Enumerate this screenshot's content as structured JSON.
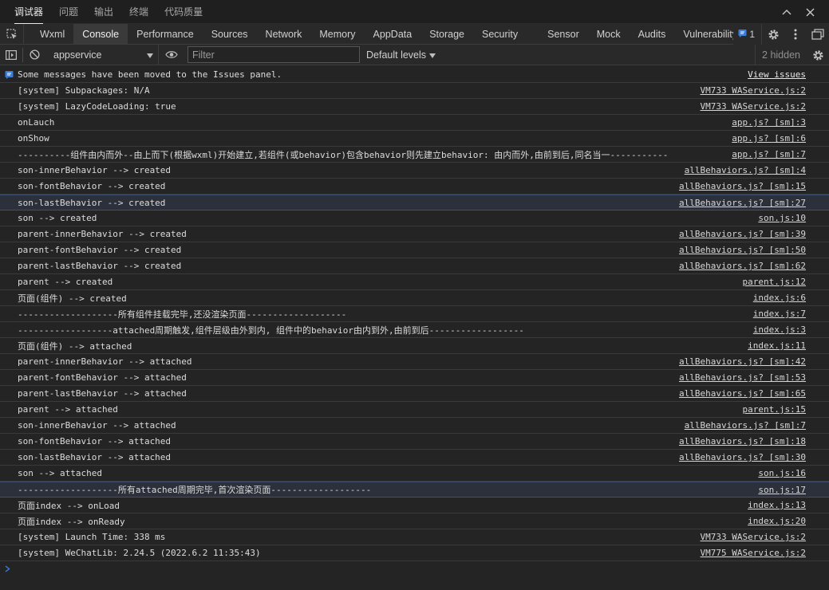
{
  "panel_tabs": [
    "调试器",
    "问题",
    "输出",
    "终端",
    "代码质量"
  ],
  "devtools_tabs": [
    "Wxml",
    "Console",
    "Performance",
    "Sources",
    "Network",
    "Memory",
    "AppData",
    "Storage",
    "Security",
    "Sensor",
    "Mock",
    "Audits",
    "Vulnerability"
  ],
  "issues_count": "1",
  "toolbar": {
    "context": "appservice",
    "filter_placeholder": "Filter",
    "levels": "Default levels",
    "hidden": "2 hidden"
  },
  "messages": [
    {
      "text": "Some messages have been moved to the Issues panel.",
      "src": "View issues"
    },
    {
      "text": "[system] Subpackages: N/A",
      "src": "VM733 WAService.js:2"
    },
    {
      "text": "[system] LazyCodeLoading: true",
      "src": "VM733 WAService.js:2"
    },
    {
      "text": "onLauch",
      "src": "app.js? [sm]:3"
    },
    {
      "text": "onShow",
      "src": "app.js? [sm]:6"
    },
    {
      "text": "----------组件由内而外--由上而下(根据wxml)开始建立,若组件(或behavior)包含behavior则先建立behavior: 由内而外,由前到后,同名当一-----------",
      "src": "app.js? [sm]:7"
    },
    {
      "text": "son-innerBehavior --> created",
      "src": "allBehaviors.js? [sm]:4"
    },
    {
      "text": "son-fontBehavior --> created",
      "src": "allBehaviors.js? [sm]:15"
    },
    {
      "text": "son-lastBehavior --> created",
      "src": "allBehaviors.js? [sm]:27"
    },
    {
      "text": "son --> created",
      "src": "son.js:10"
    },
    {
      "text": "parent-innerBehavior --> created",
      "src": "allBehaviors.js? [sm]:39"
    },
    {
      "text": "parent-fontBehavior --> created",
      "src": "allBehaviors.js? [sm]:50"
    },
    {
      "text": "parent-lastBehavior --> created",
      "src": "allBehaviors.js? [sm]:62"
    },
    {
      "text": "parent --> created",
      "src": "parent.js:12"
    },
    {
      "text": "页面(组件) --> created",
      "src": "index.js:6"
    },
    {
      "text": "-------------------所有组件挂载完毕,还没渲染页面-------------------",
      "src": "index.js:7"
    },
    {
      "text": "------------------attached周期触发,组件层级由外到内, 组件中的behavior由内到外,由前到后------------------",
      "src": "index.js:3"
    },
    {
      "text": "页面(组件) --> attached",
      "src": "index.js:11"
    },
    {
      "text": "parent-innerBehavior --> attached",
      "src": "allBehaviors.js? [sm]:42"
    },
    {
      "text": "parent-fontBehavior --> attached",
      "src": "allBehaviors.js? [sm]:53"
    },
    {
      "text": "parent-lastBehavior --> attached",
      "src": "allBehaviors.js? [sm]:65"
    },
    {
      "text": "parent --> attached",
      "src": "parent.js:15"
    },
    {
      "text": "son-innerBehavior --> attached",
      "src": "allBehaviors.js? [sm]:7"
    },
    {
      "text": "son-fontBehavior --> attached",
      "src": "allBehaviors.js? [sm]:18"
    },
    {
      "text": "son-lastBehavior --> attached",
      "src": "allBehaviors.js? [sm]:30"
    },
    {
      "text": "son --> attached",
      "src": "son.js:16"
    },
    {
      "text": "-------------------所有attached周期完毕,首次渲染页面-------------------",
      "src": "son.js:17"
    },
    {
      "text": "页面index --> onLoad",
      "src": "index.js:13"
    },
    {
      "text": "页面index --> onReady",
      "src": "index.js:20"
    },
    {
      "text": "[system] Launch Time: 338 ms",
      "src": "VM733 WAService.js:2"
    },
    {
      "text": "[system] WeChatLib: 2.24.5 (2022.6.2 11:35:43)",
      "src": "VM775 WAService.js:2"
    }
  ],
  "highlight_rows": [
    8,
    26
  ],
  "colors": {
    "accent": "#3c7ddc",
    "background": "#242424",
    "prompt": "#3c7ddc"
  }
}
